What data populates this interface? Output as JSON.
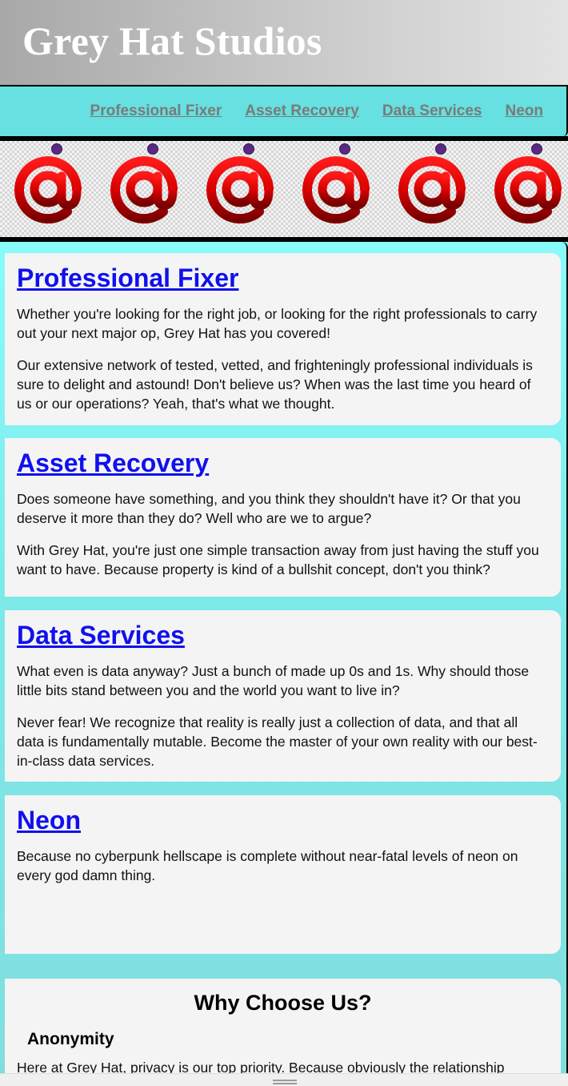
{
  "site": {
    "title": "Grey Hat Studios"
  },
  "nav": {
    "items": [
      {
        "label": "Professional Fixer"
      },
      {
        "label": "Asset Recovery"
      },
      {
        "label": "Data Services"
      },
      {
        "label": "Neon"
      }
    ]
  },
  "banner": {
    "icon": "at-sign-icon",
    "repeat": 6
  },
  "services": [
    {
      "title": "Professional Fixer",
      "paragraphs": [
        "Whether you're looking for the right job, or looking for the right professionals to carry out your next major op, Grey Hat has you covered!",
        "Our extensive network of tested, vetted, and frighteningly professional individuals is sure to delight and astound! Don't believe us? When was the last time you heard of us or our operations? Yeah, that's what we thought."
      ]
    },
    {
      "title": "Asset Recovery",
      "paragraphs": [
        "Does someone have something, and you think they shouldn't have it? Or that you deserve it more than they do? Well who are we to argue?",
        "With Grey Hat, you're just one simple transaction away from just having the stuff you want to have. Because property is kind of a bullshit concept, don't you think?"
      ]
    },
    {
      "title": "Data Services",
      "paragraphs": [
        "What even is data anyway? Just a bunch of made up 0s and 1s. Why should those little bits stand between you and the world you want to live in?",
        "Never fear! We recognize that reality is really just a collection of data, and that all data is fundamentally mutable. Become the master of your own reality with our best-in-class data services."
      ]
    },
    {
      "title": "Neon",
      "paragraphs": [
        "Because no cyberpunk hellscape is complete without near-fatal levels of neon on every god damn thing."
      ]
    }
  ],
  "why": {
    "title": "Why Choose Us?",
    "subheading": "Anonymity",
    "text": "Here at Grey Hat, privacy is our top priority. Because obviously the relationship"
  },
  "colors": {
    "header_gradient_start": "#a8a8a8",
    "header_gradient_end": "#e3e3e3",
    "nav_bg": "#66e0e0",
    "main_bg": "#88fbfb",
    "card_bg": "#f4f4f4",
    "link": "#1010ee",
    "nav_link": "#7a7a7a",
    "at_red": "#e00000",
    "at_dot": "#5a2a80"
  }
}
